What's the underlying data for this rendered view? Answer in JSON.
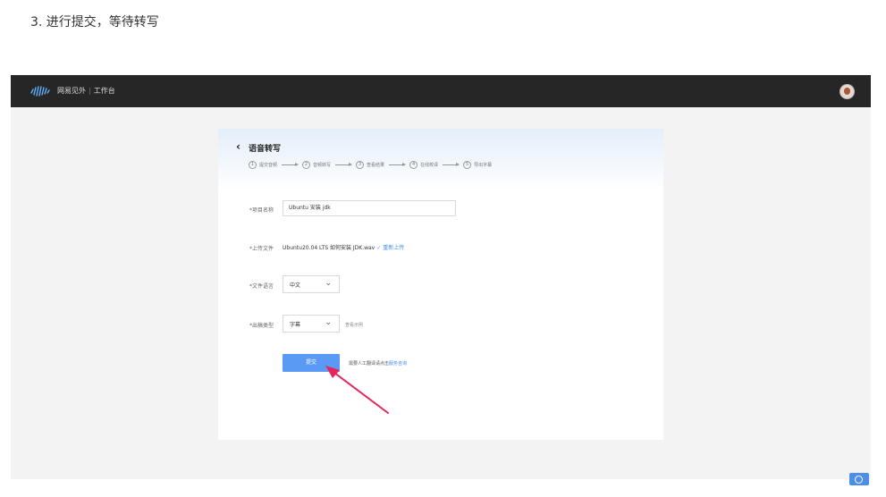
{
  "caption": "3. 进行提交，等待转写",
  "app": {
    "brand_name": "网易见外",
    "separator": "|",
    "workspace": "工作台"
  },
  "page": {
    "back_icon": "chevron-left-icon",
    "title": "语音转写",
    "steps": [
      {
        "num": "1",
        "label": "提交音频"
      },
      {
        "num": "2",
        "label": "音频转写"
      },
      {
        "num": "3",
        "label": "查看结果"
      },
      {
        "num": "4",
        "label": "在线校译"
      },
      {
        "num": "5",
        "label": "导出字幕"
      }
    ]
  },
  "form": {
    "project_name": {
      "label": "*项目名称",
      "value": "Ubuntu 安装 jdk"
    },
    "upload": {
      "label": "*上传文件",
      "filename": "Ubuntu20.04 LTS 如何安装 JDK.wav",
      "check": "✓",
      "reupload": "重新上传"
    },
    "language": {
      "label": "*文件语言",
      "value": "中文"
    },
    "output_type": {
      "label": "*出稿类型",
      "value": "字幕",
      "hint": "查看示例"
    },
    "submit_label": "提交",
    "note_text": "需要人工翻译请点击",
    "note_link": "服务咨询"
  },
  "colors": {
    "topbar": "#262626",
    "accent": "#5a9af5",
    "link": "#3b8ff0",
    "annotation_arrow": "#e8245c"
  }
}
